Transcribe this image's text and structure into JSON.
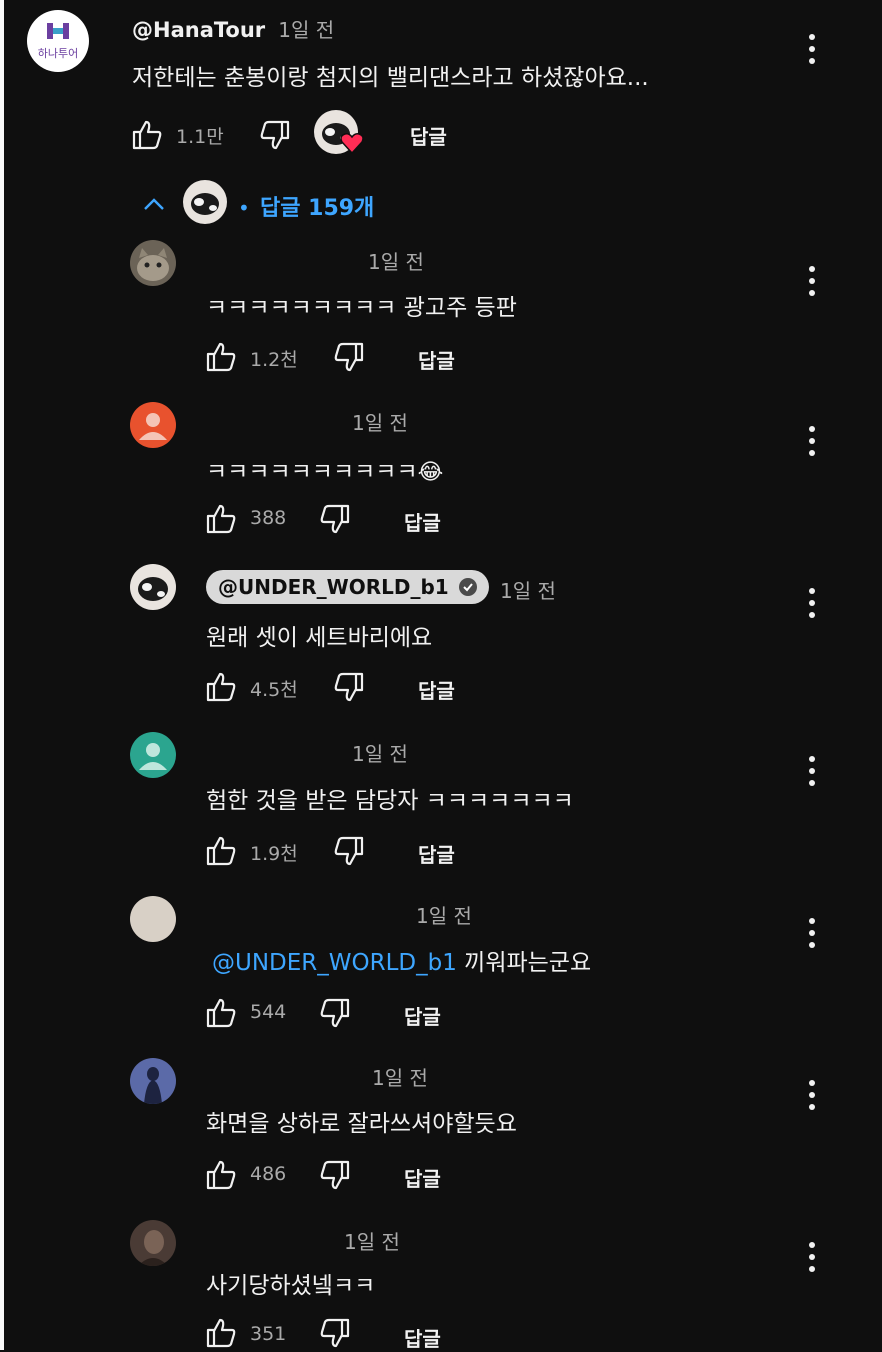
{
  "top_comment": {
    "handle": "@HanaTour",
    "time": "1일 전",
    "avatar_text": "하나투어",
    "text": "저한테는 춘봉이랑 첨지의 밸리댄스라고 하셨잖아요...",
    "likes": "1.1만",
    "reply_label": "답글",
    "replies_toggle_label": "답글 159개"
  },
  "replies": [
    {
      "handle": "",
      "time": "1일 전",
      "text": "ㅋㅋㅋㅋㅋㅋㅋㅋㅋ 광고주 등판",
      "likes": "1.2천",
      "reply_label": "답글",
      "avatar": "cat-photo",
      "color": "#6b6357"
    },
    {
      "handle": "",
      "time": "1일 전",
      "text": "ㅋㅋㅋㅋㅋㅋㅋㅋㅋㅋ",
      "emoji": "😂",
      "likes": "388",
      "reply_label": "답글",
      "avatar": "default-person",
      "color": "#e8522e"
    },
    {
      "handle": "@UNDER_WORLD_b1",
      "time": "1일 전",
      "text": "원래 셋이 세트바리에요",
      "likes": "4.5천",
      "reply_label": "답글",
      "avatar": "cow-photo",
      "verified": true
    },
    {
      "handle": "",
      "time": "1일 전",
      "text": "험한 것을 받은 담당자 ㅋㅋㅋㅋㅋㅋㅋ",
      "likes": "1.9천",
      "reply_label": "답글",
      "avatar": "default-person",
      "color": "#2ba58f"
    },
    {
      "handle": "",
      "time": "1일 전",
      "mention": "@UNDER_WORLD_b1",
      "text": "끼워파는군요",
      "likes": "544",
      "reply_label": "답글",
      "avatar": "beige-photo",
      "color": "#d8d0c6"
    },
    {
      "handle": "",
      "time": "1일 전",
      "text": "화면을 상하로 잘라쓰셔야할듯요",
      "likes": "486",
      "reply_label": "답글",
      "avatar": "silhouette-photo",
      "color": "#5b6aa8"
    },
    {
      "handle": "",
      "time": "1일 전",
      "text": "사기당하셨넼ㅋㅋ",
      "likes": "351",
      "reply_label": "답글",
      "avatar": "dark-photo",
      "color": "#4a3b35"
    }
  ]
}
